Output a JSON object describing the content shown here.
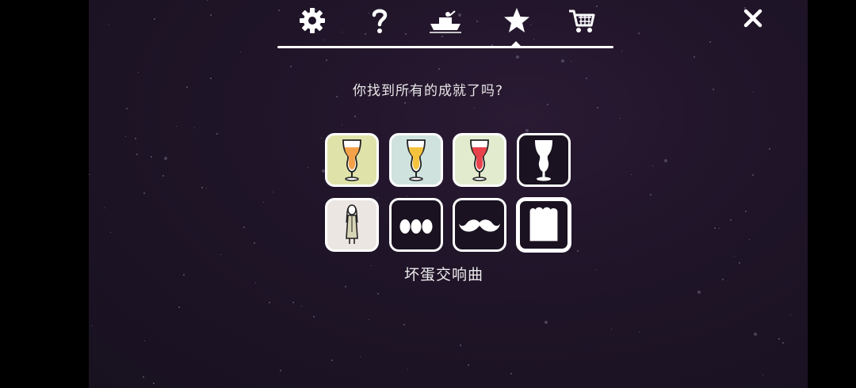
{
  "nav": {
    "items": [
      {
        "icon": "gear-icon"
      },
      {
        "icon": "question-icon"
      },
      {
        "icon": "boat-icon"
      },
      {
        "icon": "star-icon",
        "active": true
      },
      {
        "icon": "cart-icon"
      }
    ],
    "close_icon": "close-icon"
  },
  "achievements": {
    "prompt": "你找到所有的成就了吗?",
    "selected_title": "坏蛋交响曲",
    "tiles": [
      {
        "icon": "orange-drink-glass-icon",
        "bg": "#dfe3a9",
        "liquid": "#f4a24a",
        "unlocked": true
      },
      {
        "icon": "yellow-drink-glass-icon",
        "bg": "#cfe2de",
        "liquid": "#f4c23c",
        "unlocked": true
      },
      {
        "icon": "red-drink-glass-icon",
        "bg": "#e3ebcf",
        "liquid": "#e8434c",
        "unlocked": true
      },
      {
        "icon": "empty-glass-silhouette-icon",
        "unlocked": false
      },
      {
        "icon": "woman-figure-icon",
        "bg": "#ece6e2",
        "unlocked": true
      },
      {
        "icon": "three-eggs-icon",
        "unlocked": false
      },
      {
        "icon": "mustache-icon",
        "unlocked": false
      },
      {
        "icon": "bread-loaf-icon",
        "unlocked": false,
        "selected": true
      }
    ]
  },
  "colors": {
    "background": "#1f1428",
    "accent": "#ffffff"
  }
}
